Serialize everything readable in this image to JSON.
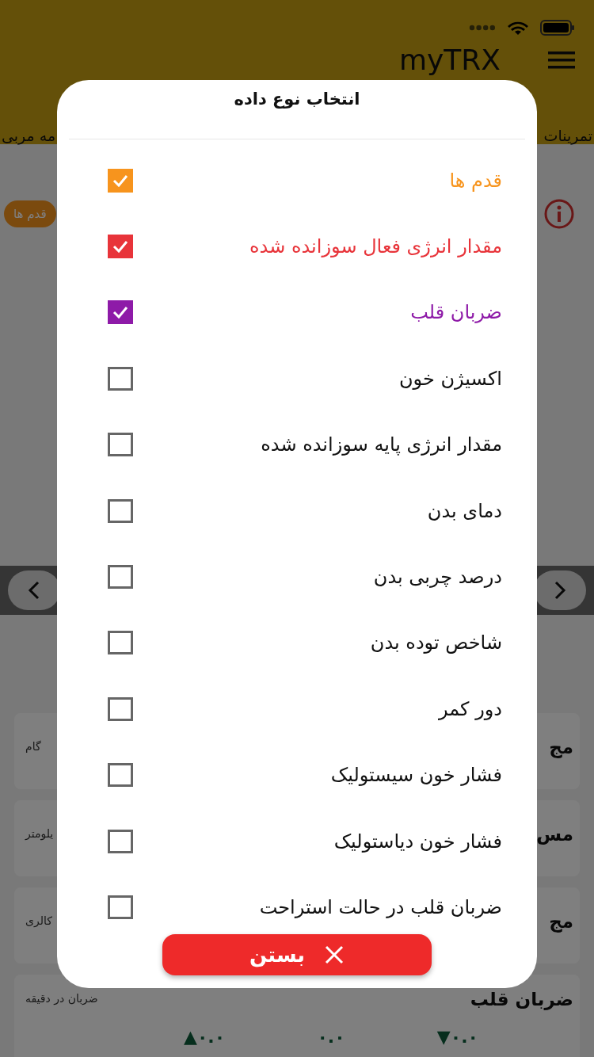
{
  "header": {
    "title": "myTRX",
    "tabs": [
      "تمرینات",
      "مه مربی"
    ]
  },
  "chip": "قدم ها",
  "cards": [
    {
      "title": "مج",
      "unit": "گام"
    },
    {
      "title": "مس",
      "unit": "یلومتر"
    },
    {
      "title": "مج",
      "unit": "کالری"
    },
    {
      "title": "ضربان قلب",
      "unit": "ضربان در دقیقه",
      "values": [
        "▼۰.۰",
        "۰.۰",
        "▲۰.۰"
      ]
    }
  ],
  "dialog": {
    "title": "انتخاب نوع داده",
    "items": [
      {
        "label": "قدم ها",
        "checked": true,
        "color": "#f7941d"
      },
      {
        "label": "مقدار انرژی فعال سوزانده شده",
        "checked": true,
        "color": "#e8343a"
      },
      {
        "label": "ضربان قلب",
        "checked": true,
        "color": "#8e1aa8"
      },
      {
        "label": "اکسیژن خون",
        "checked": false
      },
      {
        "label": "مقدار انرژی پایه سوزانده شده",
        "checked": false
      },
      {
        "label": "دمای بدن",
        "checked": false
      },
      {
        "label": "درصد چربی بدن",
        "checked": false
      },
      {
        "label": "شاخص توده بدن",
        "checked": false
      },
      {
        "label": "دور کمر",
        "checked": false
      },
      {
        "label": "فشار خون سیستولیک",
        "checked": false
      },
      {
        "label": "فشار خون دیاستولیک",
        "checked": false
      },
      {
        "label": "ضربان قلب در حالت استراحت",
        "checked": false
      }
    ],
    "close_button": "بستن"
  }
}
